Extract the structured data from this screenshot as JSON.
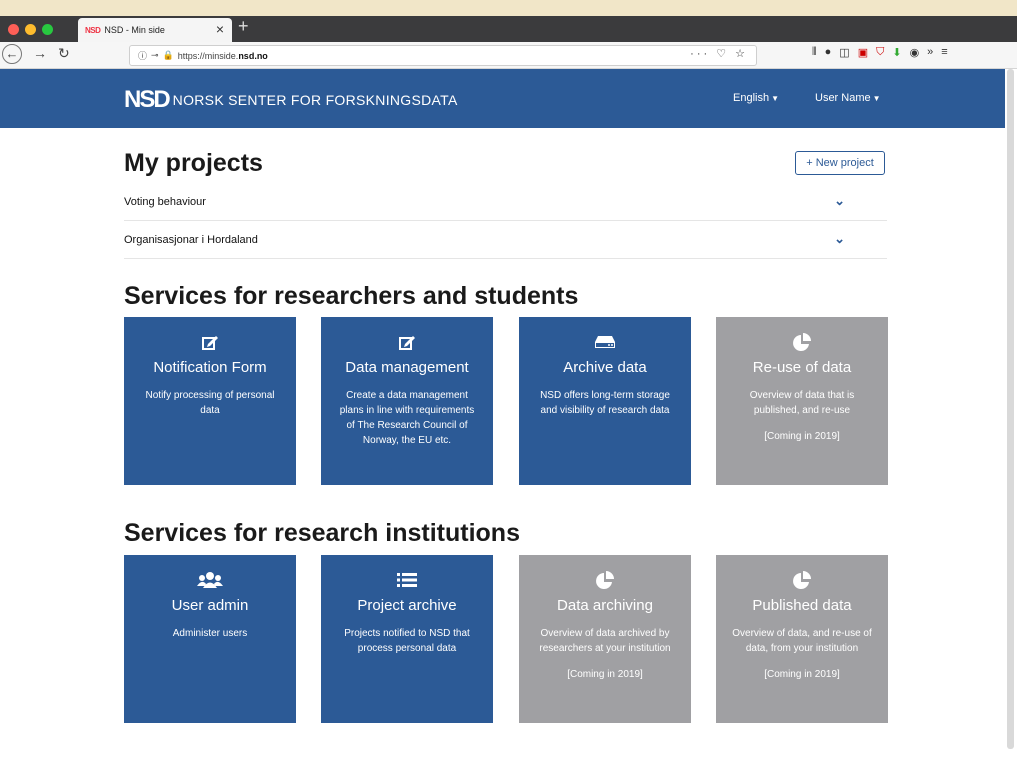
{
  "browser": {
    "tab_logo": "NSD",
    "tab_title": "NSD - Min side",
    "url_prefix": "https://minside.",
    "url_host": "nsd.no",
    "url_actions": "··· ♡ ☆"
  },
  "header": {
    "logo": "NSD",
    "brand": "NORSK SENTER FOR FORSKNINGSDATA",
    "language": "English",
    "user": "User Name"
  },
  "projects": {
    "title": "My projects",
    "new_button": "+ New project",
    "items": [
      "Voting behaviour",
      "Organisasjonar i Hordaland"
    ]
  },
  "researchers": {
    "title": "Services for researchers and students",
    "cards": [
      {
        "title": "Notification Form",
        "desc": "Notify processing of personal data",
        "soon": "",
        "icon": "edit-icon"
      },
      {
        "title": "Data management",
        "desc": "Create a data management plans in line with requirements of The Research Council of Norway, the EU etc.",
        "soon": "",
        "icon": "edit-icon"
      },
      {
        "title": "Archive data",
        "desc": "NSD offers long-term storage and visibility of research data",
        "soon": "",
        "icon": "hdd-icon"
      },
      {
        "title": "Re-use of data",
        "desc": "Overview of data that is published, and re-use",
        "soon": "[Coming in 2019]",
        "icon": "pie-chart-icon"
      }
    ]
  },
  "institutions": {
    "title": "Services for research institutions",
    "cards": [
      {
        "title": "User admin",
        "desc": "Administer users",
        "soon": "",
        "icon": "users-icon"
      },
      {
        "title": "Project archive",
        "desc": "Projects notified to NSD that process personal data",
        "soon": "",
        "icon": "list-icon"
      },
      {
        "title": "Data archiving",
        "desc": "Overview of data archived by researchers at your institution",
        "soon": "[Coming in 2019]",
        "icon": "pie-chart-icon"
      },
      {
        "title": "Published data",
        "desc": "Overview of data, and re-use of data, from your institution",
        "soon": "[Coming in 2019]",
        "icon": "pie-chart-icon"
      }
    ]
  }
}
